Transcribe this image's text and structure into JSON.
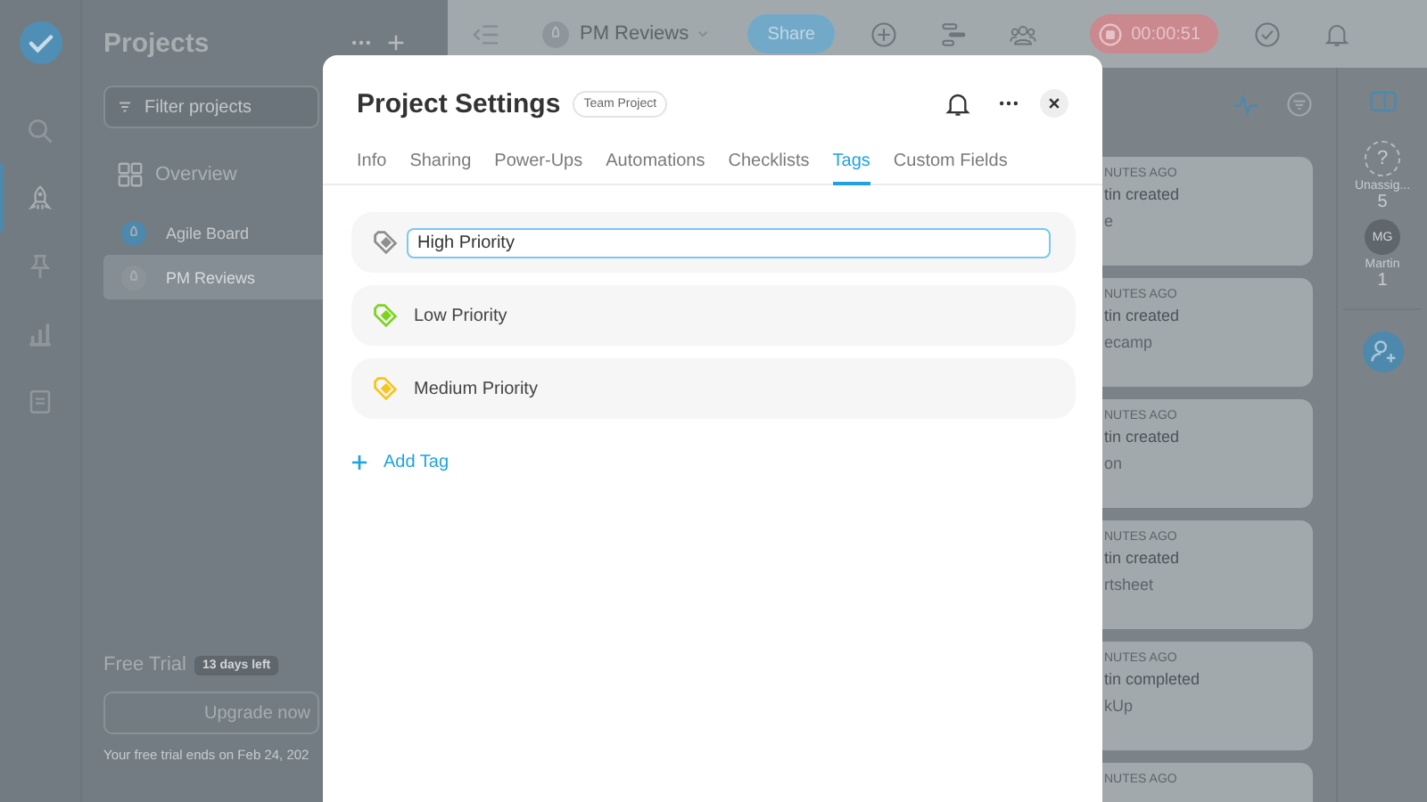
{
  "nav": [
    {
      "selected": false
    },
    {
      "selected": true
    },
    {
      "selected": false
    },
    {
      "selected": false
    },
    {
      "selected": false
    }
  ],
  "projects_panel": {
    "title": "Projects",
    "filter": {
      "placeholder": "Filter projects"
    },
    "overview": "Overview",
    "projects": [
      {
        "name": "Agile Board",
        "color": "#4d88ad",
        "selected": false
      },
      {
        "name": "PM Reviews",
        "color": "#8c9499",
        "selected": true
      }
    ],
    "trial": {
      "title": "Free Trial",
      "badge": "13 days left",
      "button": "Upgrade now",
      "note": "Your free trial ends on Feb 24, 202"
    }
  },
  "top_bar": {
    "project": "PM Reviews",
    "share": "Share",
    "timer": "00:00:51"
  },
  "activity": [
    {
      "time": "NUTES AGO",
      "text": "tin created",
      "detail": "e"
    },
    {
      "time": "NUTES AGO",
      "text": "tin created",
      "detail": "ecamp"
    },
    {
      "time": "NUTES AGO",
      "text": "tin created",
      "detail": "on"
    },
    {
      "time": "NUTES AGO",
      "text": "tin created",
      "detail": "rtsheet"
    },
    {
      "time": "NUTES AGO",
      "text": "tin completed",
      "detail": "kUp"
    },
    {
      "time": "NUTES AGO"
    }
  ],
  "people": [
    {
      "kind": "unassigned",
      "symbol": "?",
      "name": "Unassig...",
      "count": "5"
    },
    {
      "kind": "member",
      "initials": "MG",
      "name": "Martin",
      "count": "1"
    }
  ],
  "modal": {
    "title": "Project Settings",
    "badge": "Team Project",
    "tabs": [
      {
        "label": "Info",
        "selected": false
      },
      {
        "label": "Sharing",
        "selected": false
      },
      {
        "label": "Power-Ups",
        "selected": false
      },
      {
        "label": "Automations",
        "selected": false
      },
      {
        "label": "Checklists",
        "selected": false
      },
      {
        "label": "Tags",
        "selected": true
      },
      {
        "label": "Custom Fields",
        "selected": false
      }
    ],
    "tags": [
      {
        "name": "High Priority",
        "color": "#8e8e8e",
        "editing": true
      },
      {
        "name": "Low Priority",
        "color": "#7ed321",
        "editing": false
      },
      {
        "name": "Medium Priority",
        "color": "#f8c51c",
        "editing": false
      }
    ],
    "add_tag": "Add Tag"
  }
}
